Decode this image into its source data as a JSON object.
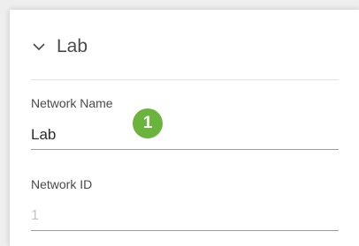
{
  "section": {
    "title": "Lab",
    "chevron_icon": "chevron-down-icon"
  },
  "fields": {
    "network_name": {
      "label": "Network Name",
      "value": "Lab",
      "placeholder": ""
    },
    "network_id": {
      "label": "Network ID",
      "value": "",
      "placeholder": "1"
    }
  },
  "annotation": {
    "step_number": "1",
    "color": "#6ab43e"
  },
  "colors": {
    "background": "#eeeeee",
    "card": "#ffffff",
    "text": "#4a4a4a",
    "underline": "#9b9b9b",
    "placeholder": "#c4c4c4"
  }
}
